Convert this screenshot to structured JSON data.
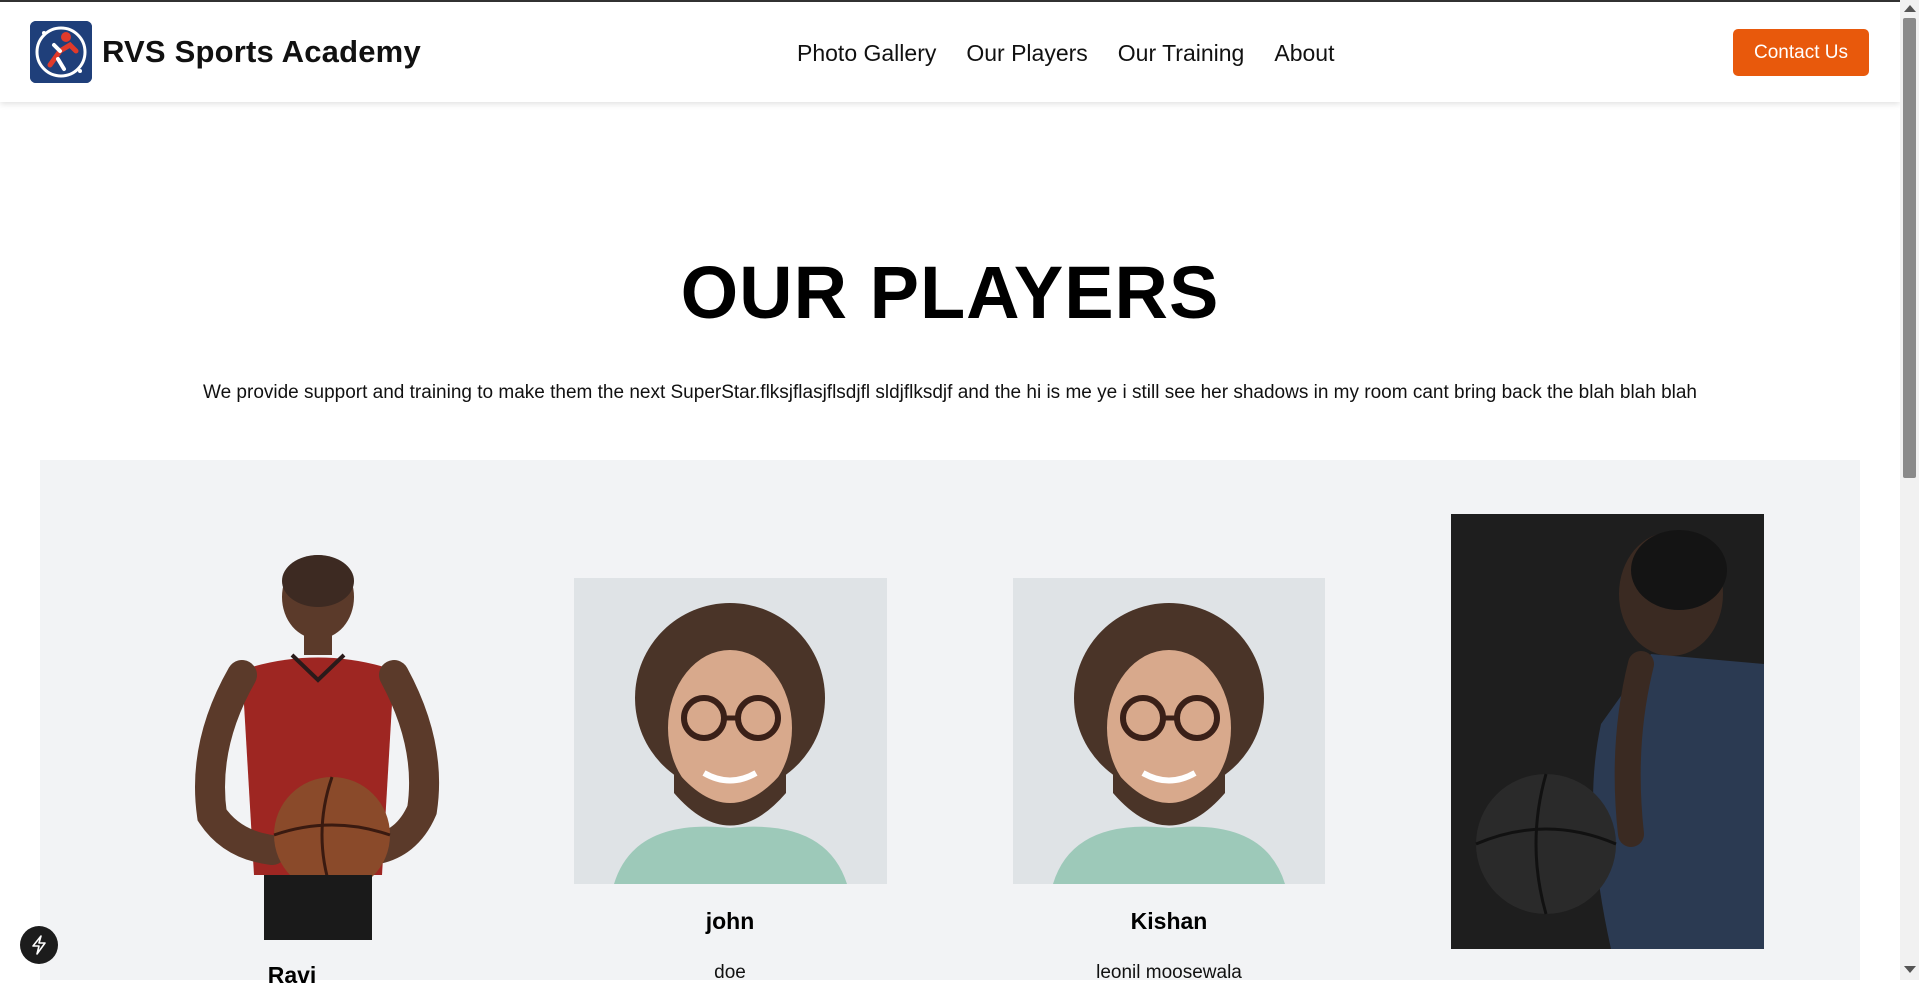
{
  "header": {
    "brand": "RVS Sports Academy",
    "nav": [
      "Photo Gallery",
      "Our Players",
      "Our Training",
      "About"
    ],
    "contact_label": "Contact Us"
  },
  "main": {
    "title": "OUR PLAYERS",
    "intro": "We provide support and training to make them the next SuperStar.flksjflasjflsdjfl sldjflksdjf and the hi is me ye i still see her shadows in my room cant bring back the blah blah blah"
  },
  "players": [
    {
      "name": "Ravi",
      "sub": ""
    },
    {
      "name": "john",
      "sub": "doe"
    },
    {
      "name": "Kishan",
      "sub": "leonil moosewala"
    },
    {
      "name": "",
      "sub": ""
    }
  ],
  "colors": {
    "accent": "#e8590c",
    "panel": "#f2f3f5",
    "logo": "#1f3f7a"
  },
  "icons": {
    "logo": "sports-logo-icon",
    "bolt": "lightning-icon"
  }
}
